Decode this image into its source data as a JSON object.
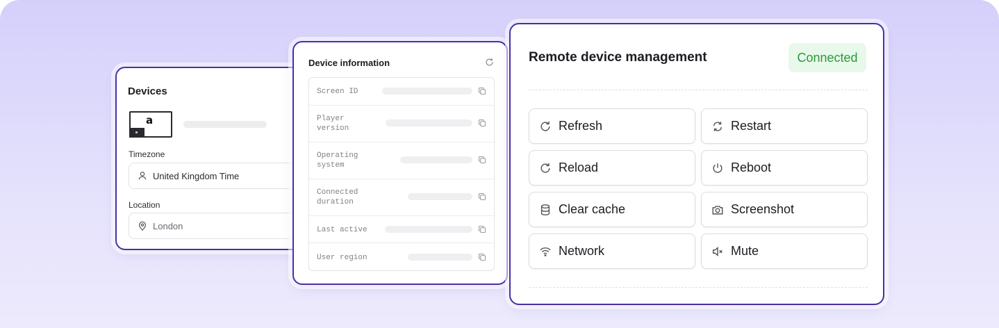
{
  "devices": {
    "title": "Devices",
    "device_logo": "a",
    "timezone_label": "Timezone",
    "timezone_value": "United Kingdom Time",
    "location_label": "Location",
    "location_value": "London"
  },
  "device_info": {
    "title": "Device information",
    "rows": [
      {
        "label": "Screen ID"
      },
      {
        "label": "Player\nversion"
      },
      {
        "label": "Operating\nsystem"
      },
      {
        "label": "Connected\nduration"
      },
      {
        "label": "Last active"
      },
      {
        "label": "User region"
      }
    ]
  },
  "remote": {
    "title": "Remote device management",
    "status": "Connected",
    "status_color": "#2b9a3a",
    "actions": [
      {
        "label": "Refresh",
        "icon": "refresh-icon"
      },
      {
        "label": "Restart",
        "icon": "restart-icon"
      },
      {
        "label": "Reload",
        "icon": "reload-icon"
      },
      {
        "label": "Reboot",
        "icon": "power-icon"
      },
      {
        "label": "Clear cache",
        "icon": "database-icon"
      },
      {
        "label": "Screenshot",
        "icon": "camera-icon"
      },
      {
        "label": "Network",
        "icon": "wifi-icon"
      },
      {
        "label": "Mute",
        "icon": "mute-icon"
      }
    ]
  },
  "colors": {
    "accent_border": "#4a2fa6",
    "background": "#dcd8fc"
  }
}
